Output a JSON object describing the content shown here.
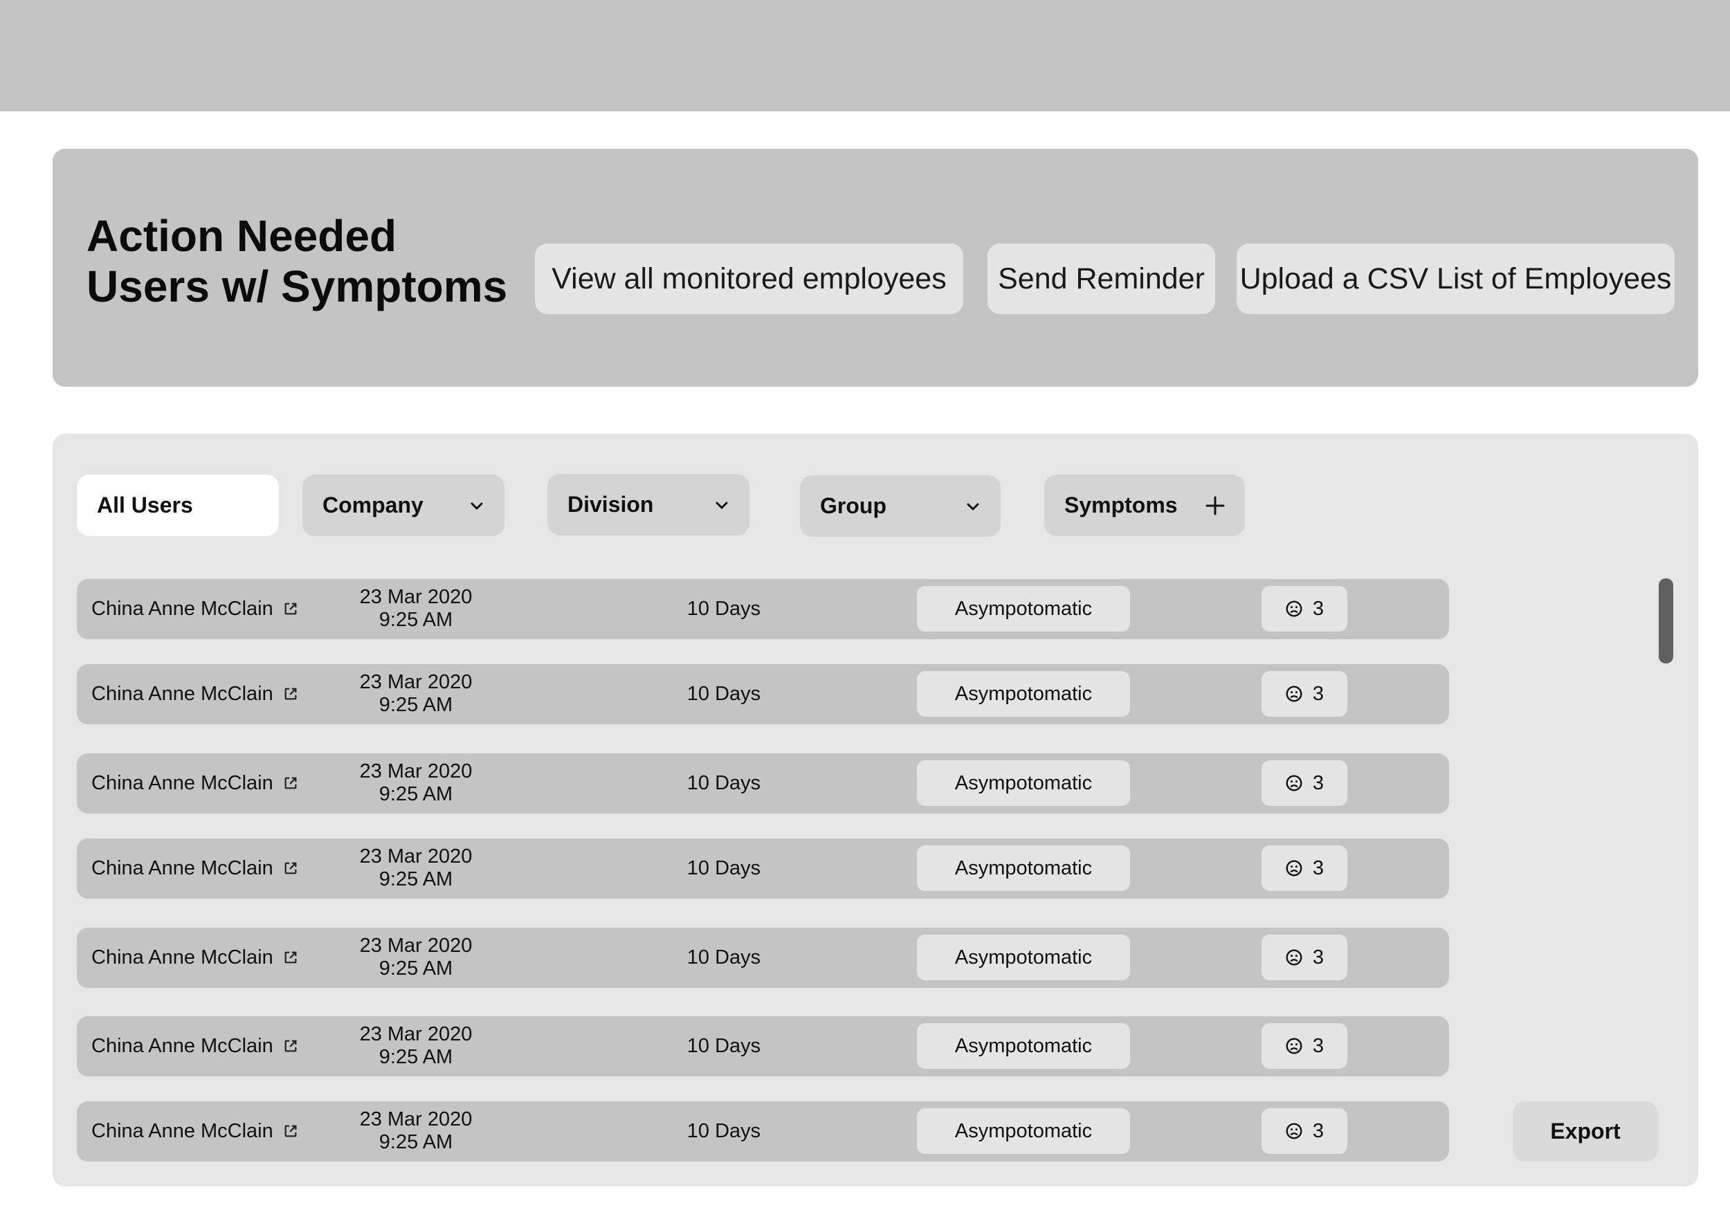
{
  "header": {
    "title_line1": "Action Needed",
    "title_line2": "Users w/ Symptoms",
    "actions": [
      "View all monitored employees",
      "Send Reminder",
      "Upload a CSV List of Employees"
    ]
  },
  "filters": {
    "all_users": "All Users",
    "company": "Company",
    "division": "Division",
    "group": "Group",
    "symptoms": "Symptoms",
    "icons": {
      "company": "chevron-down-icon",
      "division": "chevron-down-icon",
      "group": "chevron-down-icon",
      "symptoms": "plus-icon"
    }
  },
  "rows": [
    {
      "name": "China Anne McClain",
      "date": "23 Mar 2020",
      "time": "9:25 AM",
      "days": "10 Days",
      "status": "Asympotomatic",
      "count": "3"
    },
    {
      "name": "China Anne McClain",
      "date": "23 Mar 2020",
      "time": "9:25 AM",
      "days": "10 Days",
      "status": "Asympotomatic",
      "count": "3"
    },
    {
      "name": "China Anne McClain",
      "date": "23 Mar 2020",
      "time": "9:25 AM",
      "days": "10 Days",
      "status": "Asympotomatic",
      "count": "3"
    },
    {
      "name": "China Anne McClain",
      "date": "23 Mar 2020",
      "time": "9:25 AM",
      "days": "10 Days",
      "status": "Asympotomatic",
      "count": "3"
    },
    {
      "name": "China Anne McClain",
      "date": "23 Mar 2020",
      "time": "9:25 AM",
      "days": "10 Days",
      "status": "Asympotomatic",
      "count": "3"
    },
    {
      "name": "China Anne McClain",
      "date": "23 Mar 2020",
      "time": "9:25 AM",
      "days": "10 Days",
      "status": "Asympotomatic",
      "count": "3"
    },
    {
      "name": "China Anne McClain",
      "date": "23 Mar 2020",
      "time": "9:25 AM",
      "days": "10 Days",
      "status": "Asympotomatic",
      "count": "3"
    }
  ],
  "row_icons": {
    "name_link": "external-link-icon",
    "count": "sad-face-icon"
  },
  "export": "Export",
  "colors": {
    "topbar": "#c4c4c4",
    "panel": "#c4c4c4",
    "list_panel": "#e6e6e6",
    "row": "#c4c4c4",
    "pill": "#e4e4e4",
    "active_filter": "#ffffff",
    "scrollbar": "#606060"
  }
}
